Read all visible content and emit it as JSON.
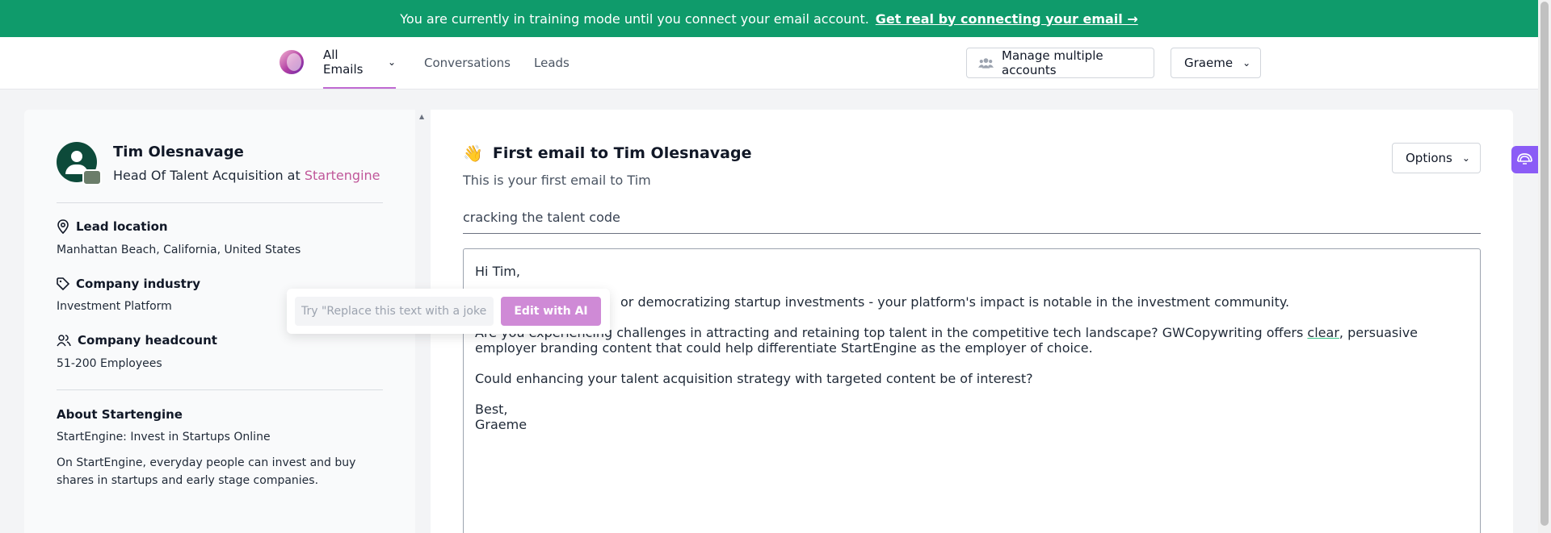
{
  "banner": {
    "text": "You are currently in training mode until you connect your email account.",
    "link": "Get real by connecting your email →"
  },
  "nav": {
    "tabs": [
      {
        "label": "All Emails"
      },
      {
        "label": "Conversations"
      },
      {
        "label": "Leads"
      }
    ],
    "manage_label": "Manage multiple accounts",
    "user_label": "Graeme"
  },
  "lead": {
    "name": "Tim Olesnavage",
    "role_prefix": "Head Of Talent Acquisition at",
    "company": "Startengine",
    "location_label": "Lead location",
    "location": "Manhattan Beach, California, United States",
    "industry_label": "Company industry",
    "industry": "Investment Platform",
    "headcount_label": "Company headcount",
    "headcount": "51-200 Employees",
    "about_label": "About Startengine",
    "about_title": "StartEngine: Invest in Startups Online",
    "about_desc": "On StartEngine, everyday people can invest and buy shares in startups and early stage companies."
  },
  "email": {
    "wave": "👋",
    "title": "First email to Tim Olesnavage",
    "subtitle": "This is your first email to Tim",
    "options_label": "Options",
    "subject": "cracking the talent code",
    "greeting": "Hi Tim,",
    "para1_visible": "or democratizing startup investments - your platform's impact is notable in the investment community.",
    "para2_start": "Are you experiencing challenges in attracting and retaining top talent in the competitive tech landscape? GWCopywriting offers ",
    "para2_spell": "clear",
    "para2_end": ", persuasive employer branding content that could help differentiate StartEngine as the employer of choice.",
    "para3": "Could enhancing your talent acquisition strategy with targeted content be of interest?",
    "signoff": "Best,",
    "signature": "Graeme"
  },
  "ai_popup": {
    "placeholder": "Try \"Replace this text with a joke\"",
    "button": "Edit with AI"
  },
  "colors": {
    "brand_green": "#0f9b6b",
    "accent_pink": "#c0579a",
    "ai_purple": "#cf8ad6",
    "ext_purple": "#8b5cf6"
  }
}
